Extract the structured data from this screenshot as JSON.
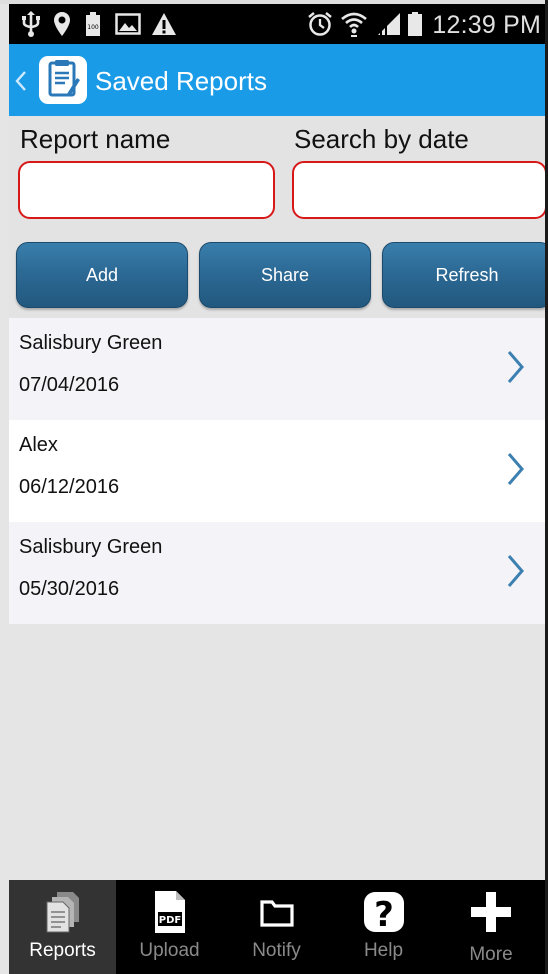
{
  "status_bar": {
    "time": "12:39 PM",
    "icons": [
      "usb-icon",
      "location-icon",
      "battery-full-icon",
      "gallery-icon",
      "warning-icon",
      "alarm-icon",
      "wifi-icon",
      "signal-icon",
      "battery-icon"
    ]
  },
  "action_bar": {
    "title": "Saved Reports",
    "back_icon": "chevron-left-icon",
    "app_icon": "report-app-icon"
  },
  "form": {
    "report_name_label": "Report name",
    "report_name_value": "",
    "search_date_label": "Search by date",
    "search_date_value": ""
  },
  "buttons": {
    "add": "Add",
    "share": "Share",
    "refresh": "Refresh"
  },
  "reports": [
    {
      "name": "Salisbury Green",
      "date": "07/04/2016"
    },
    {
      "name": "Alex",
      "date": "06/12/2016"
    },
    {
      "name": "Salisbury Green",
      "date": "05/30/2016"
    }
  ],
  "bottom_nav": {
    "reports": "Reports",
    "upload": "Upload",
    "notify": "Notify",
    "help": "Help",
    "more": "More",
    "active": "reports"
  },
  "colors": {
    "action_bar": "#1a9be8",
    "button": "#2b6893",
    "input_border": "#d81818",
    "chevron": "#3c7fb1"
  }
}
